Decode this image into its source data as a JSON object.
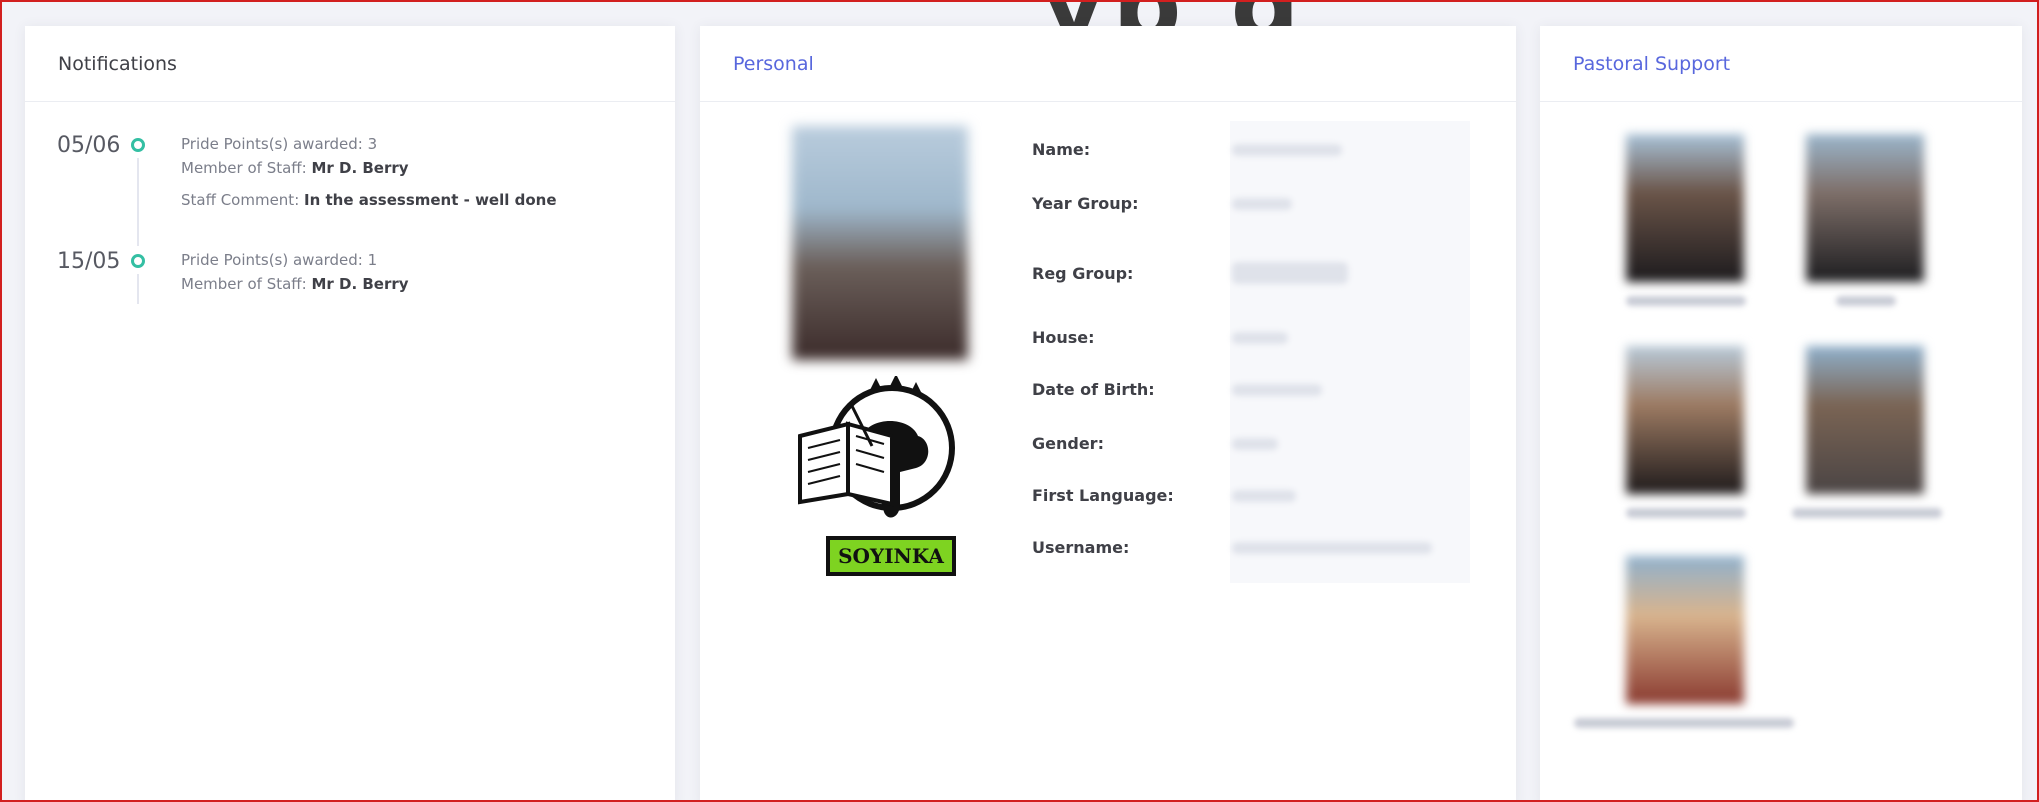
{
  "notifications": {
    "title": "Notifications",
    "items": [
      {
        "date": "05/06",
        "points_text": "Pride Points(s) awarded: 3",
        "staff_prefix": "Member of Staff: ",
        "staff_name": "Mr D. Berry",
        "comment_prefix": "Staff Comment: ",
        "comment": "In the assessment - well done"
      },
      {
        "date": "15/05",
        "points_text": "Pride Points(s) awarded: 1",
        "staff_prefix": "Member of Staff: ",
        "staff_name": "Mr D. Berry"
      }
    ],
    "accent_color": "#34bfa3"
  },
  "personal": {
    "title": "Personal",
    "house_badge": "SOYINKA",
    "fields": [
      {
        "label": "Name:"
      },
      {
        "label": "Year Group:"
      },
      {
        "label": "Reg Group:"
      },
      {
        "label": "House:"
      },
      {
        "label": "Date of Birth:"
      },
      {
        "label": "Gender:"
      },
      {
        "label": "First Language:"
      },
      {
        "label": "Username:"
      }
    ],
    "title_color": "#5867dd",
    "badge_color": "#7ed321"
  },
  "pastoral": {
    "title": "Pastoral Support"
  },
  "frame_color": "#d21f1f"
}
